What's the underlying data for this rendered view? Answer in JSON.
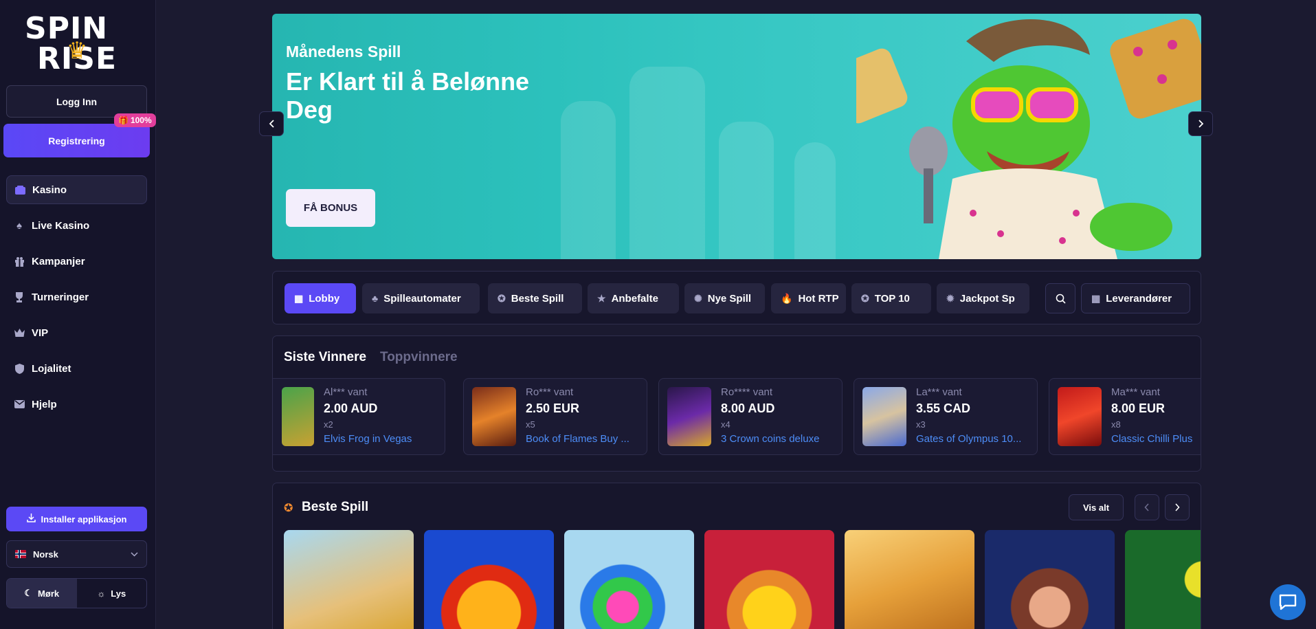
{
  "brand": {
    "line1": "SPIN",
    "line2": "RISE"
  },
  "auth": {
    "login_label": "Logg Inn",
    "register_label": "Registrering",
    "register_badge": "100%"
  },
  "nav": [
    {
      "label": "Kasino",
      "icon": "casino-icon",
      "active": true
    },
    {
      "label": "Live Kasino",
      "icon": "spade-icon",
      "active": false
    },
    {
      "label": "Kampanjer",
      "icon": "gift-icon",
      "active": false
    },
    {
      "label": "Turneringer",
      "icon": "trophy-icon",
      "active": false
    },
    {
      "label": "VIP",
      "icon": "crown-icon",
      "active": false
    },
    {
      "label": "Lojalitet",
      "icon": "shield-icon",
      "active": false
    },
    {
      "label": "Hjelp",
      "icon": "mail-icon",
      "active": false
    }
  ],
  "install_label": "Installer applikasjon",
  "language": {
    "selected": "Norsk"
  },
  "theme": {
    "dark_label": "Mørk",
    "light_label": "Lys",
    "selected": "dark"
  },
  "hero": {
    "subtitle": "Månedens Spill",
    "title": "Er Klart til å Belønne Deg",
    "cta_label": "FÅ BONUS"
  },
  "categories": [
    {
      "label": "Lobby",
      "active": true
    },
    {
      "label": "Spilleautomater",
      "active": false
    },
    {
      "label": "Beste Spill",
      "active": false
    },
    {
      "label": "Anbefalte",
      "active": false
    },
    {
      "label": "Nye Spill",
      "active": false
    },
    {
      "label": "Hot RTP",
      "active": false
    },
    {
      "label": "TOP 10",
      "active": false
    },
    {
      "label": "Jackpot Sp",
      "active": false
    }
  ],
  "providers_label": "Leverandører",
  "winners": {
    "tab_active": "Siste Vinnere",
    "tab_inactive": "Toppvinnere",
    "items": [
      {
        "user": "Al*** vant",
        "amount": "2.00 AUD",
        "multiplier": "x2",
        "game": "Elvis Frog in Vegas"
      },
      {
        "user": "Ro*** vant",
        "amount": "2.50 EUR",
        "multiplier": "x5",
        "game": "Book of Flames Buy ..."
      },
      {
        "user": "Ro**** vant",
        "amount": "8.00 AUD",
        "multiplier": "x4",
        "game": "3 Crown coins deluxe"
      },
      {
        "user": "La*** vant",
        "amount": "3.55 CAD",
        "multiplier": "x3",
        "game": "Gates of Olympus 10..."
      },
      {
        "user": "Ma*** vant",
        "amount": "8.00 EUR",
        "multiplier": "x8",
        "game": "Classic Chilli Plus"
      }
    ]
  },
  "best_games": {
    "title": "Beste Spill",
    "view_all_label": "Vis alt"
  },
  "colors": {
    "accent": "#5b49f5",
    "badge": "#e23e9b",
    "link": "#4d8df7",
    "bg": "#1b1a30"
  }
}
